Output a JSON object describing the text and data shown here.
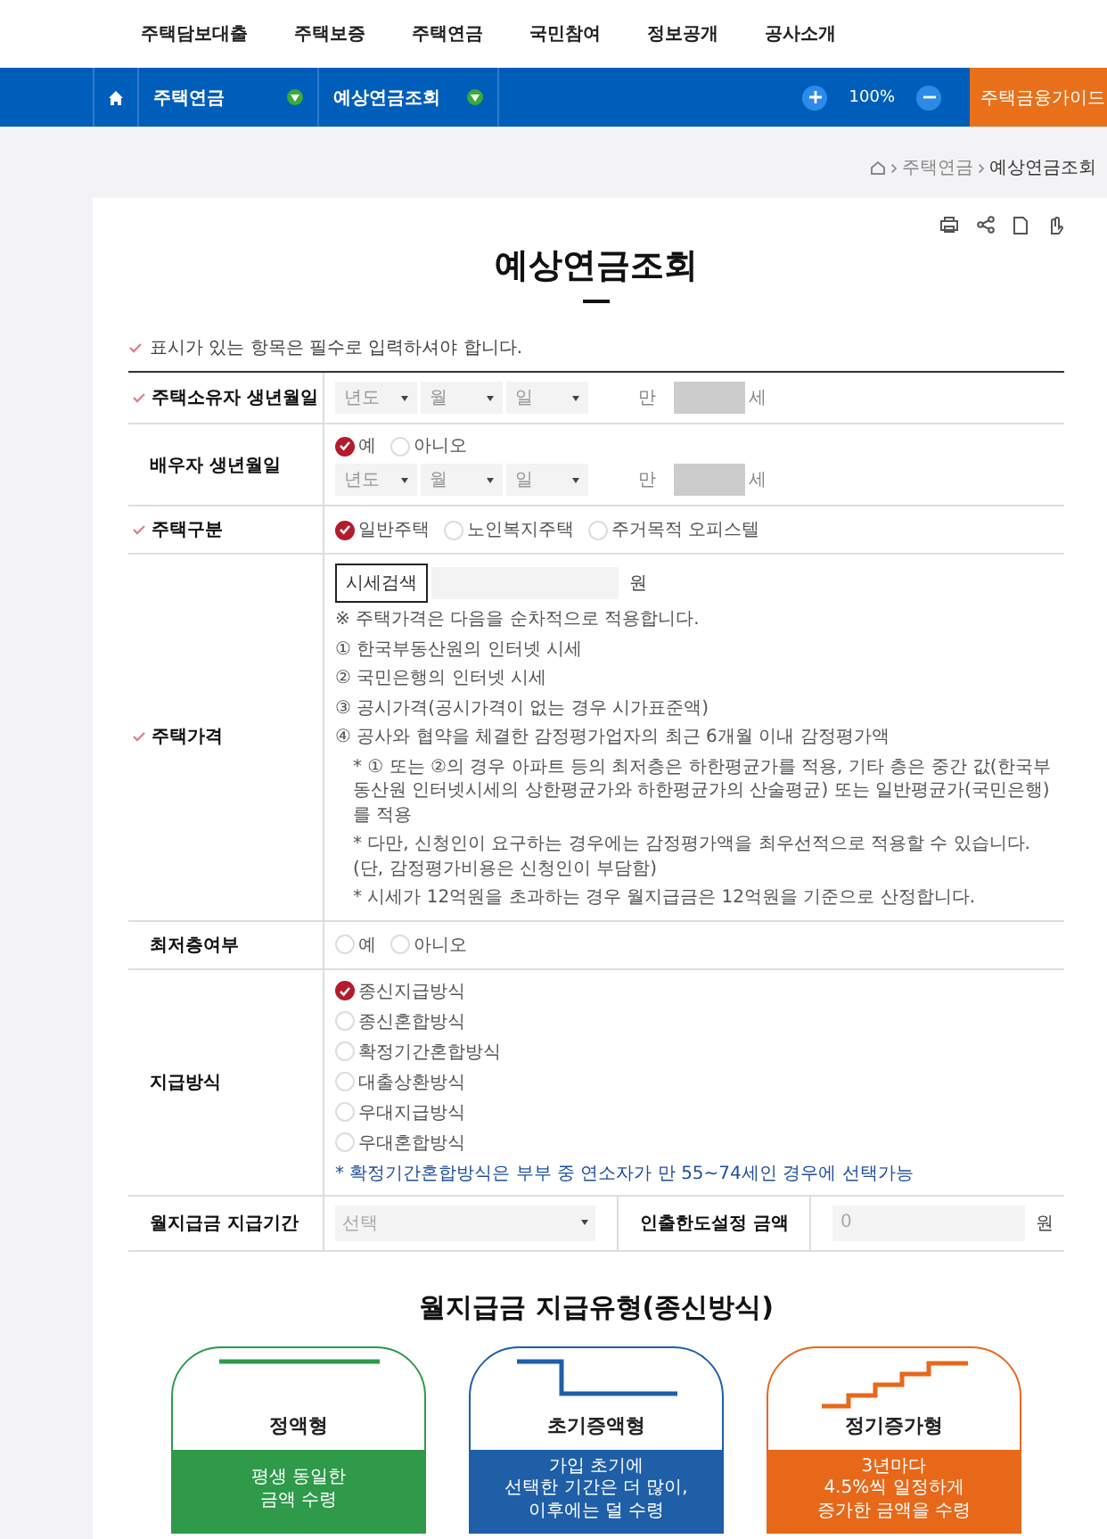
{
  "top_nav": [
    "주택담보대출",
    "주택보증",
    "주택연금",
    "국민참여",
    "정보공개",
    "공사소개"
  ],
  "nav_bar": {
    "menus": [
      {
        "label": "주택연금"
      },
      {
        "label": "예상연금조회"
      }
    ],
    "zoom": "100%",
    "guide": "주택금융가이드"
  },
  "breadcrumb": [
    "주택연금",
    "예상연금조회"
  ],
  "page_title": "예상연금조회",
  "required_note": "표시가 있는 항목은 필수로 입력하셔야 합니다.",
  "form": [
    {
      "kind": "birth",
      "label": "주택소유자 생년월일",
      "required": true,
      "selects": [
        "년도",
        "월",
        "일"
      ],
      "age_prefix": "만",
      "age_suffix": "세"
    },
    {
      "kind": "spouse",
      "label": "배우자 생년월일",
      "required": false,
      "options": [
        {
          "label": "예",
          "selected": true
        },
        {
          "label": "아니오",
          "selected": false
        }
      ],
      "selects": [
        "년도",
        "월",
        "일"
      ],
      "age_prefix": "만",
      "age_suffix": "세"
    },
    {
      "kind": "radios",
      "label": "주택구분",
      "required": true,
      "options": [
        {
          "label": "일반주택",
          "selected": true
        },
        {
          "label": "노인복지주택",
          "selected": false
        },
        {
          "label": "주거목적 오피스텔",
          "selected": false
        }
      ]
    },
    {
      "kind": "price",
      "label": "주택가격",
      "required": true,
      "search_button": "시세검색",
      "unit": "원",
      "intro": "※ 주택가격은 다음을 순차적으로 적용합니다.",
      "items": [
        "① 한국부동산원의 인터넷 시세",
        "② 국민은행의 인터넷 시세",
        "③ 공시가격(공시가격이 없는 경우 시가표준액)",
        "④ 공사와 협약을 체결한 감정평가업자의 최근 6개월 이내 감정평가액"
      ],
      "notes": [
        "* ① 또는 ②의 경우 아파트 등의 최저층은 하한평균가를 적용, 기타 층은 중간 값(한국부동산원 인터넷시세의 상한평균가와 하한평균가의 산술평균) 또는 일반평균가(국민은행)를 적용",
        "* 다만, 신청인이 요구하는 경우에는 감정평가액을 최우선적으로 적용할 수 있습니다. (단, 감정평가비용은 신청인이 부담함)",
        "* 시세가 12억원을 초과하는 경우 월지급금은 12억원을 기준으로 산정합니다."
      ]
    },
    {
      "kind": "radios",
      "label": "최저층여부",
      "required": false,
      "options": [
        {
          "label": "예",
          "selected": false
        },
        {
          "label": "아니오",
          "selected": false
        }
      ]
    },
    {
      "kind": "radio_list",
      "label": "지급방식",
      "required": false,
      "options": [
        {
          "label": "종신지급방식",
          "selected": true
        },
        {
          "label": "종신혼합방식",
          "selected": false
        },
        {
          "label": "확정기간혼합방식",
          "selected": false
        },
        {
          "label": "대출상환방식",
          "selected": false
        },
        {
          "label": "우대지급방식",
          "selected": false
        },
        {
          "label": "우대혼합방식",
          "selected": false
        }
      ],
      "note": "* 확정기간혼합방식은 부부 중 연소자가 만 55~74세인 경우에 선택가능"
    },
    {
      "kind": "pair",
      "label": "월지급금 지급기간",
      "required": false,
      "select": "선택",
      "label2": "인출한도설정 금액",
      "value": "0",
      "unit": "원"
    }
  ],
  "types_title": "월지급금 지급유형(종신방식)",
  "types": [
    {
      "kind": "flat",
      "name": "정액형",
      "color": "#2e9a4a",
      "description": "평생 동일한\n금액 수령"
    },
    {
      "kind": "drop",
      "name": "초기증액형",
      "color": "#1f5fa8",
      "description": "가입 초기에\n선택한 기간은 더 많이,\n이후에는 덜 수령"
    },
    {
      "kind": "steps",
      "name": "정기증가형",
      "color": "#e8681a",
      "description": "3년마다\n4.5%씩 일정하게\n증가한 금액을 수령"
    }
  ]
}
